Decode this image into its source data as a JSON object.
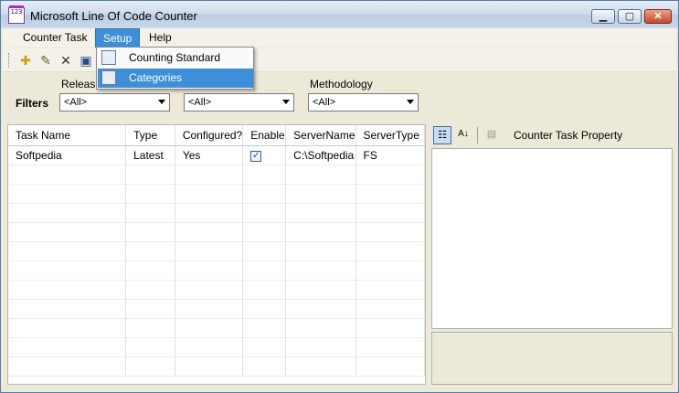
{
  "window": {
    "title": "Microsoft Line Of Code Counter",
    "app_icon_text": "123"
  },
  "menu": {
    "items": [
      {
        "label": "Counter Task"
      },
      {
        "label": "Setup"
      },
      {
        "label": "Help"
      }
    ],
    "setup_dropdown": [
      {
        "label": "Counting Standard",
        "icon": "document-icon"
      },
      {
        "label": "Categories",
        "icon": "categories-icon"
      }
    ]
  },
  "filters": {
    "label": "Filters",
    "release": {
      "caption": "Release",
      "value": "<All>"
    },
    "second": {
      "value": "<All>"
    },
    "methodology": {
      "caption": "Methodology",
      "value": "<All>"
    }
  },
  "grid": {
    "columns": [
      "Task Name",
      "Type",
      "Configured?",
      "Enable",
      "ServerName",
      "ServerType"
    ],
    "rows": [
      {
        "task_name": "Softpedia",
        "type": "Latest",
        "configured": "Yes",
        "enable": true,
        "server_name": "C:\\Softpedia",
        "server_type": "FS"
      }
    ]
  },
  "property_panel": {
    "title": "Counter Task Property"
  }
}
